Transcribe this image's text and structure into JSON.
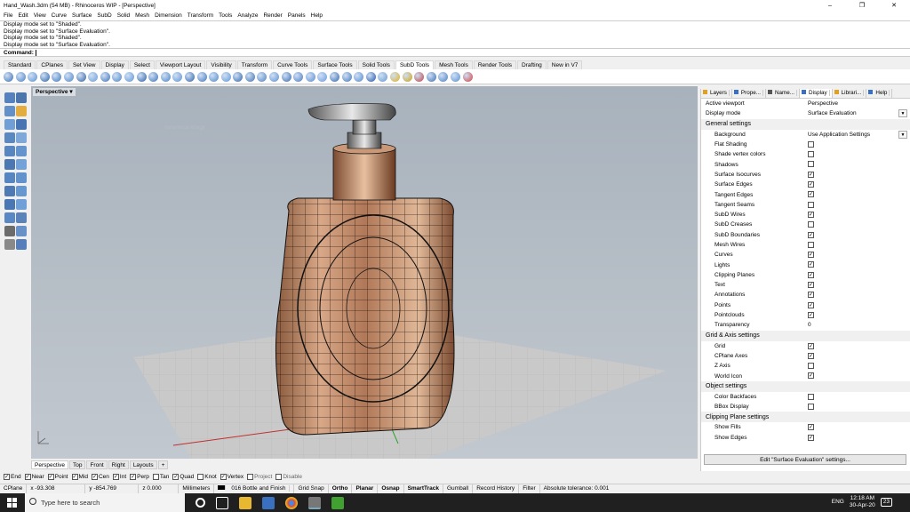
{
  "window": {
    "title": "Hand_Wash.3dm (54 MB) - Rhinoceros WIP - [Perspective]"
  },
  "menu": [
    "File",
    "Edit",
    "View",
    "Curve",
    "Surface",
    "SubD",
    "Solid",
    "Mesh",
    "Dimension",
    "Transform",
    "Tools",
    "Analyze",
    "Render",
    "Panels",
    "Help"
  ],
  "history": [
    "Display mode set to \"Shaded\".",
    "Display mode set to \"Surface Evaluation\".",
    "Display mode set to \"Shaded\".",
    "Display mode set to \"Surface Evaluation\"."
  ],
  "command": {
    "label": "Command:"
  },
  "tabs": [
    "Standard",
    "CPlanes",
    "Set View",
    "Display",
    "Select",
    "Viewport Layout",
    "Visibility",
    "Transform",
    "Curve Tools",
    "Surface Tools",
    "Solid Tools",
    "SubD Tools",
    "Mesh Tools",
    "Render Tools",
    "Drafting",
    "New in V7"
  ],
  "active_tab": "SubD Tools",
  "toolbar_colors": [
    "#3a6fb5",
    "#4a7fc2",
    "#5a8fd0",
    "#2d62a8",
    "#3e75bb",
    "#4d86c8",
    "#2f5f9f",
    "#6a9ad6",
    "#3c73b8",
    "#4c84c6",
    "#5c94d4",
    "#2a5ea6",
    "#3b72b9",
    "#4b82c4",
    "#5b92d2",
    "#2e61a7",
    "#3f76bc",
    "#4f87c9",
    "#5f97d7",
    "#3064aa",
    "#4070b0",
    "#5080c0",
    "#6090d0",
    "#3a6ab0",
    "#4a7ac0",
    "#5a8ad0",
    "#6a9ae0",
    "#3366aa",
    "#4477bb",
    "#5588cc",
    "#2255aa",
    "#6699cc",
    "#e0b020",
    "#d0a010",
    "#c04040",
    "#3a6fb5",
    "#4a7fc2",
    "#5a8fd0",
    "#d04040"
  ],
  "viewport": {
    "label": "Perspective",
    "watermark": "Reference Image"
  },
  "viewport_tabs": [
    "Perspective",
    "Top",
    "Front",
    "Right",
    "Layouts"
  ],
  "osnaps": [
    {
      "label": "End",
      "checked": true
    },
    {
      "label": "Near",
      "checked": true
    },
    {
      "label": "Point",
      "checked": true
    },
    {
      "label": "Mid",
      "checked": true
    },
    {
      "label": "Cen",
      "checked": true
    },
    {
      "label": "Int",
      "checked": true
    },
    {
      "label": "Perp",
      "checked": true
    },
    {
      "label": "Tan",
      "checked": false
    },
    {
      "label": "Quad",
      "checked": true
    },
    {
      "label": "Knot",
      "checked": false
    },
    {
      "label": "Vertex",
      "checked": true
    },
    {
      "label": "Project",
      "checked": false
    },
    {
      "label": "Disable",
      "checked": false
    }
  ],
  "status": {
    "cplane": "CPlane",
    "x": "x -93.308",
    "y": "y -854.769",
    "z": "z 0.000",
    "units": "Millimeters",
    "layer": "016 Bottle and Finish",
    "toggles": [
      "Grid Snap",
      "Ortho",
      "Planar",
      "Osnap",
      "SmartTrack",
      "Gumball",
      "Record History",
      "Filter"
    ],
    "tolerance": "Absolute tolerance: 0.001"
  },
  "panel": {
    "tabs": [
      "Layers",
      "Prope...",
      "Name...",
      "Display",
      "Librari...",
      "Help"
    ],
    "active_viewport_label": "Active viewport",
    "active_viewport_value": "Perspective",
    "display_mode_label": "Display mode",
    "display_mode_value": "Surface Evaluation",
    "general_title": "General settings",
    "background_label": "Background",
    "background_value": "Use Application Settings",
    "general_items": [
      {
        "label": "Flat Shading",
        "checked": false
      },
      {
        "label": "Shade vertex colors",
        "checked": false
      },
      {
        "label": "Shadows",
        "checked": false
      },
      {
        "label": "Surface Isocurves",
        "checked": true
      },
      {
        "label": "Surface Edges",
        "checked": true
      },
      {
        "label": "Tangent Edges",
        "checked": true
      },
      {
        "label": "Tangent Seams",
        "checked": false
      },
      {
        "label": "SubD Wires",
        "checked": true
      },
      {
        "label": "SubD Creases",
        "checked": false
      },
      {
        "label": "SubD Boundaries",
        "checked": true
      },
      {
        "label": "Mesh Wires",
        "checked": false
      },
      {
        "label": "Curves",
        "checked": true
      },
      {
        "label": "Lights",
        "checked": true
      },
      {
        "label": "Clipping Planes",
        "checked": true
      },
      {
        "label": "Text",
        "checked": true
      },
      {
        "label": "Annotations",
        "checked": true
      },
      {
        "label": "Points",
        "checked": true
      },
      {
        "label": "Pointclouds",
        "checked": true
      }
    ],
    "transparency_label": "Transparency",
    "transparency_value": "0",
    "grid_title": "Grid & Axis settings",
    "grid_items": [
      {
        "label": "Grid",
        "checked": true
      },
      {
        "label": "CPlane Axes",
        "checked": true
      },
      {
        "label": "Z Axis",
        "checked": false
      },
      {
        "label": "World Icon",
        "checked": true
      }
    ],
    "object_title": "Object settings",
    "object_items": [
      {
        "label": "Color Backfaces",
        "checked": false
      },
      {
        "label": "BBox Display",
        "checked": false
      }
    ],
    "clipping_title": "Clipping Plane settings",
    "clipping_items": [
      {
        "label": "Show Fills",
        "checked": true
      },
      {
        "label": "Show Edges",
        "checked": true
      }
    ],
    "edit_button": "Edit \"Surface Evaluation\" settings..."
  },
  "taskbar": {
    "search_placeholder": "Type here to search",
    "time": "12:18 AM",
    "date": "30-Apr-20",
    "lang": "ENG",
    "notif": "23"
  }
}
